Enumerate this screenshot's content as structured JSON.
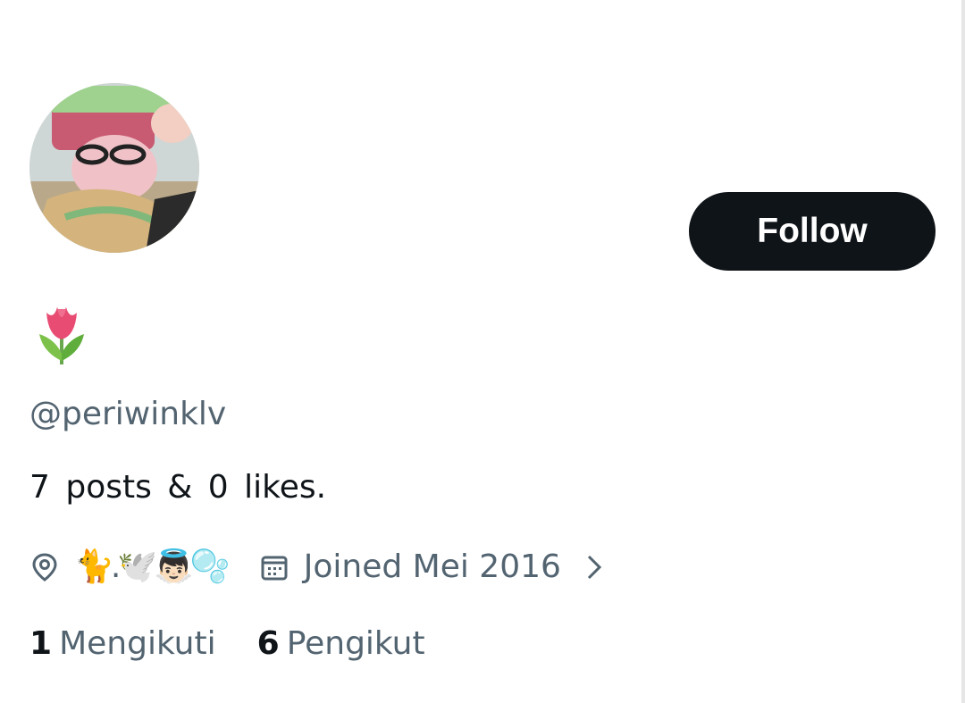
{
  "profile": {
    "display_name": "🌷",
    "handle": "@periwinklv",
    "bio": "7 posts & 0 likes.",
    "location": "🐈‍.🕊️👼🏻🫧",
    "joined": "Joined Mei 2016",
    "follow_label": "Follow",
    "following": {
      "count": "1",
      "label": "Mengikuti"
    },
    "followers": {
      "count": "6",
      "label": "Pengikut"
    }
  },
  "icons": {
    "location": "location-pin-icon",
    "calendar": "calendar-icon",
    "chevron": "chevron-right-icon"
  },
  "colors": {
    "text_primary": "#0f1419",
    "text_secondary": "#536471",
    "follow_button_bg": "#0f1419",
    "follow_button_text": "#ffffff"
  }
}
